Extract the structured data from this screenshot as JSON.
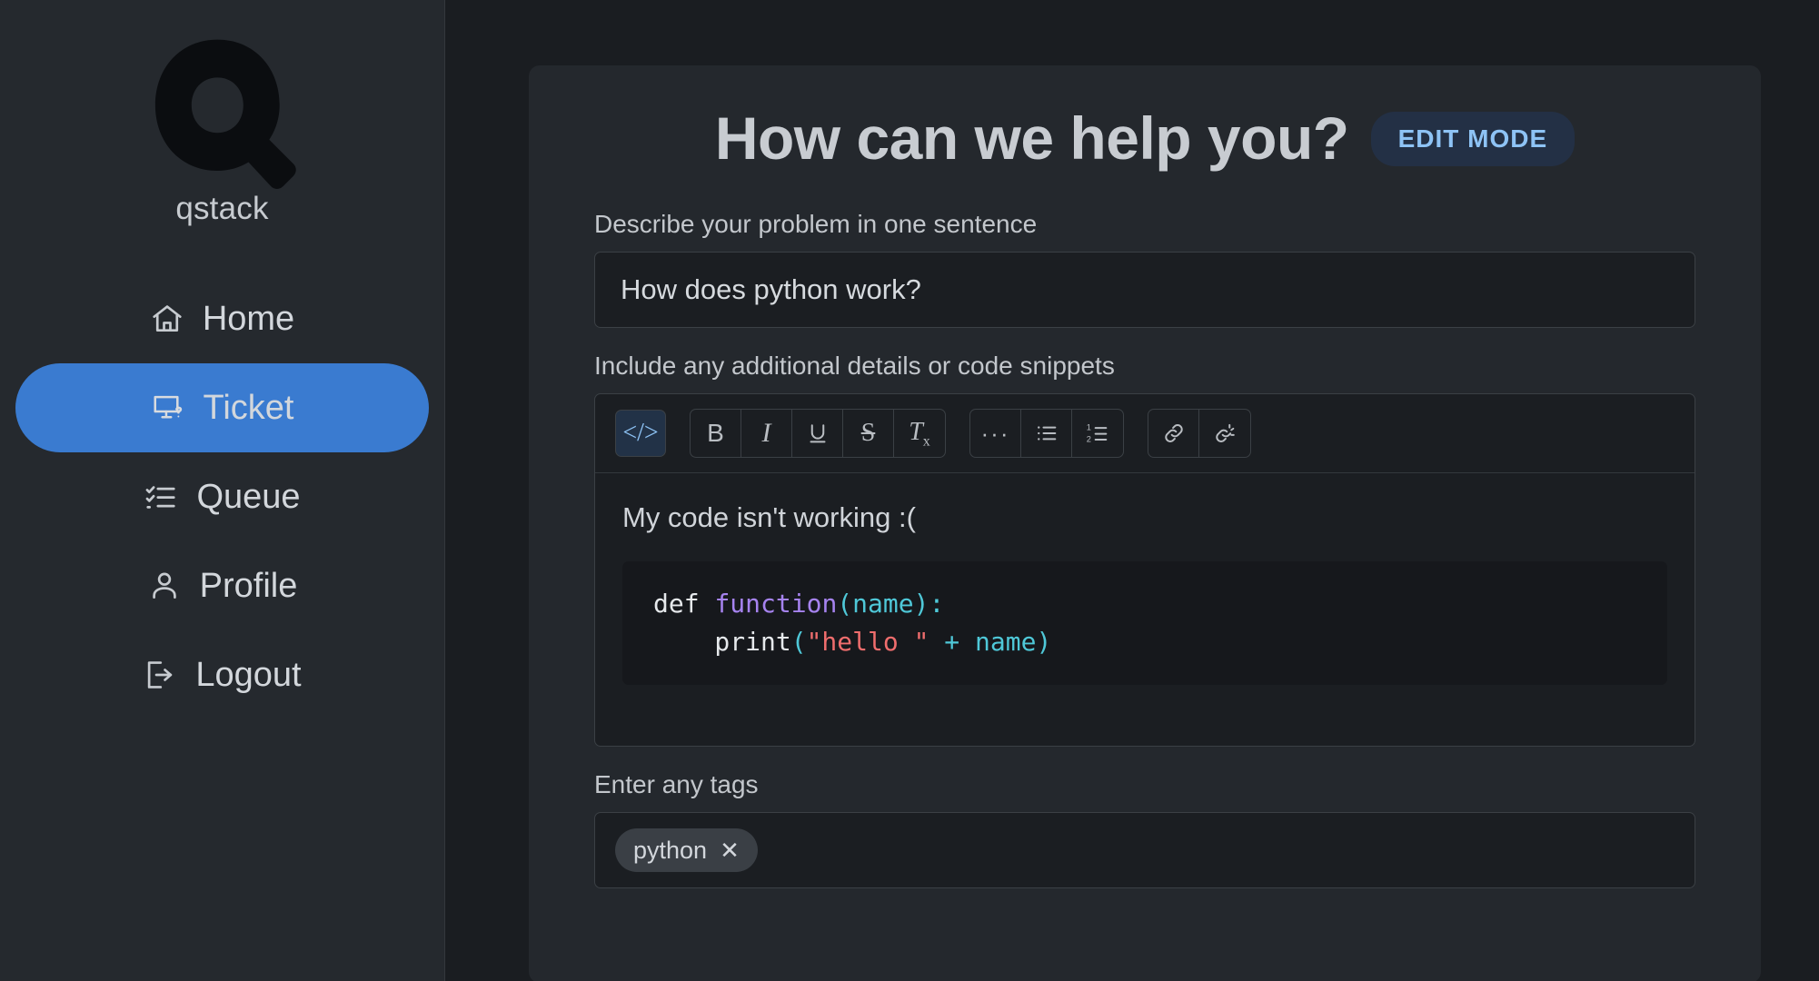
{
  "sidebar": {
    "brand": {
      "logo_icon": "letter-q-logo",
      "name": "qstack"
    },
    "items": [
      {
        "label": "Home",
        "icon": "house-icon",
        "active": false
      },
      {
        "label": "Ticket",
        "icon": "monitor-question-icon",
        "active": true
      },
      {
        "label": "Queue",
        "icon": "checklist-icon",
        "active": false
      },
      {
        "label": "Profile",
        "icon": "person-icon",
        "active": false
      },
      {
        "label": "Logout",
        "icon": "sign-out-icon",
        "active": false
      }
    ]
  },
  "main": {
    "title": "How can we help you?",
    "edit_mode_label": "EDIT MODE",
    "problem_field": {
      "label": "Describe your problem in one sentence",
      "value": "How does python work?",
      "placeholder": "Describe your problem in one sentence"
    },
    "details_field": {
      "label": "Include any additional details or code snippets",
      "paragraph": "My code isn't working :(",
      "code": {
        "line1_keyword": "def ",
        "line1_func": "function",
        "line1_params": "(name)",
        "line1_colon": ":",
        "line2_call": "    print",
        "line2_open": "(",
        "line2_string": "\"hello \"",
        "line2_plus": " + ",
        "line2_name": "name)"
      },
      "toolbar": {
        "code_label": "</>",
        "bold_label": "B",
        "italic_label": "I",
        "underline_label": "U",
        "strike_label": "S",
        "clear_format_label": "T",
        "clear_format_sub": "x",
        "hr_label": "···",
        "bullet_list_icon": "bullet-list-icon",
        "numbered_list_icon": "numbered-list-icon",
        "link_icon": "link-icon",
        "unlink_icon": "unlink-icon"
      }
    },
    "tags_field": {
      "label": "Enter any tags",
      "tags": [
        {
          "name": "python",
          "remove_label": "✕"
        }
      ]
    }
  },
  "colors": {
    "accent_blue": "#3a7bd0",
    "edit_mode_text": "#8ec3f5",
    "edit_mode_bg": "#233045",
    "sidebar_bg": "#25292e",
    "main_bg": "#1a1d21",
    "card_bg": "#24282d",
    "input_bg": "#1b1e22",
    "code_bg": "#16181c"
  }
}
